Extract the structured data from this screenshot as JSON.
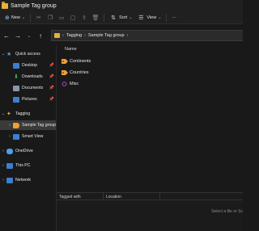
{
  "window": {
    "title": "Sample Tag group"
  },
  "toolbar": {
    "new_label": "New",
    "sort_label": "Sort",
    "view_label": "View",
    "more_label": "···"
  },
  "address": {
    "crumbs": [
      "Tagging",
      "Sample Tag group"
    ]
  },
  "sidebar": {
    "quick_access": "Quick access",
    "items": [
      {
        "label": "Desktop"
      },
      {
        "label": "Downloads"
      },
      {
        "label": "Documents"
      },
      {
        "label": "Pictures"
      }
    ],
    "tagging": "Tagging",
    "tagging_children": [
      {
        "label": "Sample Tag group"
      },
      {
        "label": "Smart View"
      }
    ],
    "onedrive": "OneDrive",
    "this_pc": "This PC",
    "network": "Network"
  },
  "content": {
    "column_name": "Name",
    "files": [
      {
        "label": "Continents"
      },
      {
        "label": "Countries"
      },
      {
        "label": "Misc"
      }
    ]
  },
  "bottom_pane": {
    "columns": [
      "Tagged with",
      "Location"
    ],
    "hint": "Select a file or Sc"
  },
  "colors": {
    "folder": "#e3b341",
    "tag": "#f0a030",
    "misc": "#b04ad8",
    "accent": "#4c9fe6"
  }
}
